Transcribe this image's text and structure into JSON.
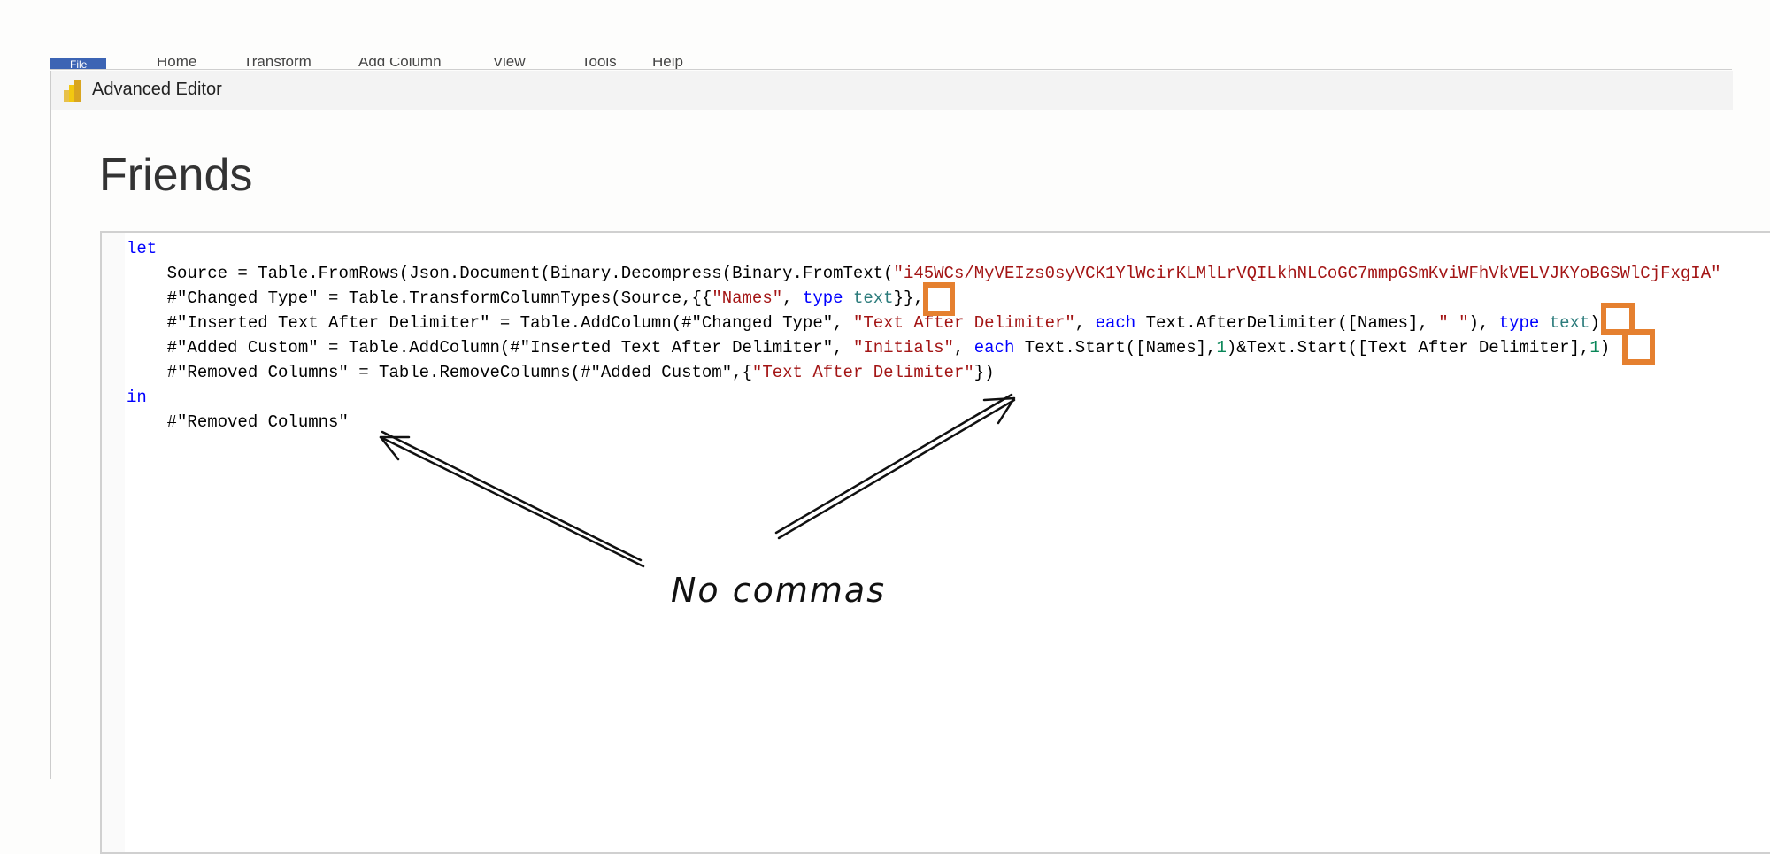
{
  "ribbon": {
    "tabs": [
      "File",
      "Home",
      "Transform",
      "Add Column",
      "View",
      "Tools",
      "Help"
    ]
  },
  "window": {
    "title": "Advanced Editor",
    "icon": "power-bi-icon"
  },
  "query_name": "Friends",
  "code": {
    "let": "let",
    "l1a": "    Source = Table.FromRows(Json.Document(Binary.Decompress(Binary.FromText(",
    "l1s": "\"i45WCs/MyVEIzs0syVCK1YlWcirKLMlLrVQILkhNLCoGC7mmpGSmKviWFhVkVELVJKYoBGSWlCjFxgIA\"",
    "l2a": "    #\"Changed Type\" = Table.TransformColumnTypes(Source,{{",
    "l2s": "\"Names\"",
    "l2b": ", ",
    "l2k": "type",
    "l2t": "text",
    "l2c": "}},",
    "l3a": "    #\"Inserted Text After Delimiter\" = Table.AddColumn(#\"Changed Type\", ",
    "l3s": "\"Text After Delimiter\"",
    "l3b": ", ",
    "l3k": "each",
    "l3c": " Text.AfterDelimiter([Names], ",
    "l3s2": "\" \"",
    "l3d": "), ",
    "l3k2": "type",
    "l3t": "text",
    "l3e": "),",
    "l4a": "    #\"Added Custom\" = Table.AddColumn(#\"Inserted Text After Delimiter\", ",
    "l4s": "\"Initials\"",
    "l4b": ", ",
    "l4k": "each",
    "l4c": " Text.Start([Names],",
    "l4n": "1",
    "l4d": ")&Text.Start([Text After Delimiter],",
    "l4n2": "1",
    "l4e": ") ,",
    "l5a": "    #\"Removed Columns\" = Table.RemoveColumns(#\"Added Custom\",{",
    "l5s": "\"Text After Delimiter\"",
    "l5b": "})",
    "in": "in",
    "l7": "    #\"Removed Columns\""
  },
  "annotation": {
    "text": "No commas",
    "color": "#e5802f"
  }
}
